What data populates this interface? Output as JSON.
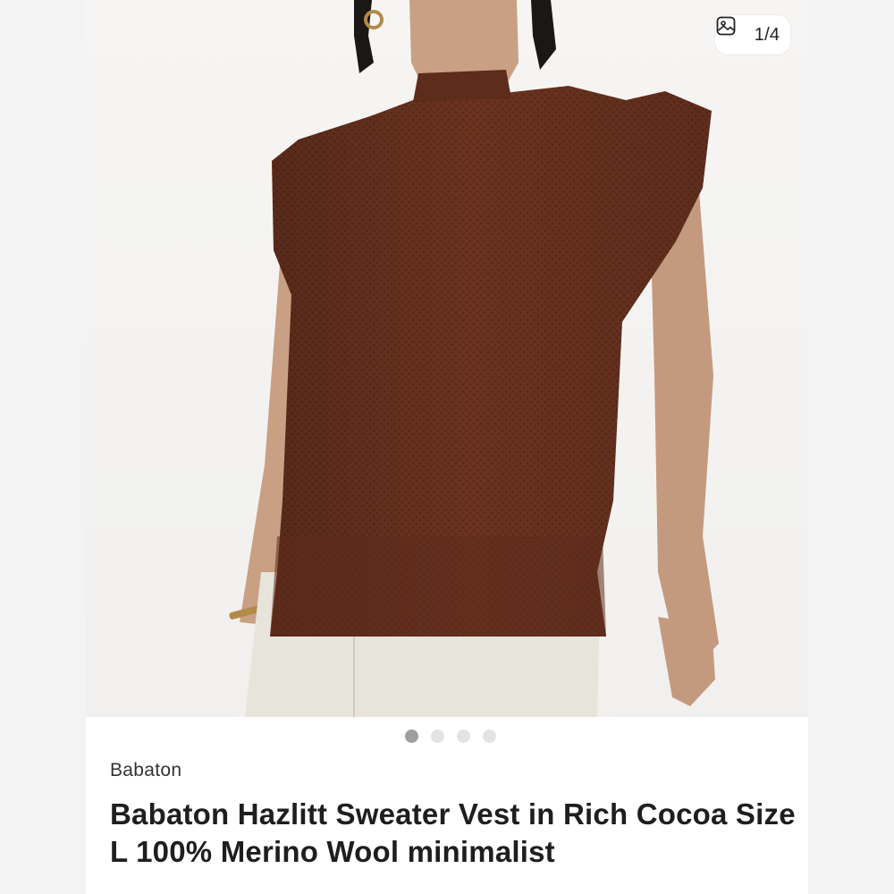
{
  "gallery": {
    "counter_text": "1/4",
    "counter_icon": "image-icon",
    "dots": [
      true,
      false,
      false,
      false
    ],
    "photo_alt": "Model wearing a brown knit sleeveless sweater vest with white trousers"
  },
  "listing": {
    "brand": "Babaton",
    "title": "Babaton Hazlitt Sweater Vest in Rich Cocoa Size L 100% Merino Wool minimalist"
  },
  "colors": {
    "vest": "#6e3520",
    "skin": "#c9a084",
    "hair": "#1b1715",
    "pants": "#e7e4dc"
  }
}
